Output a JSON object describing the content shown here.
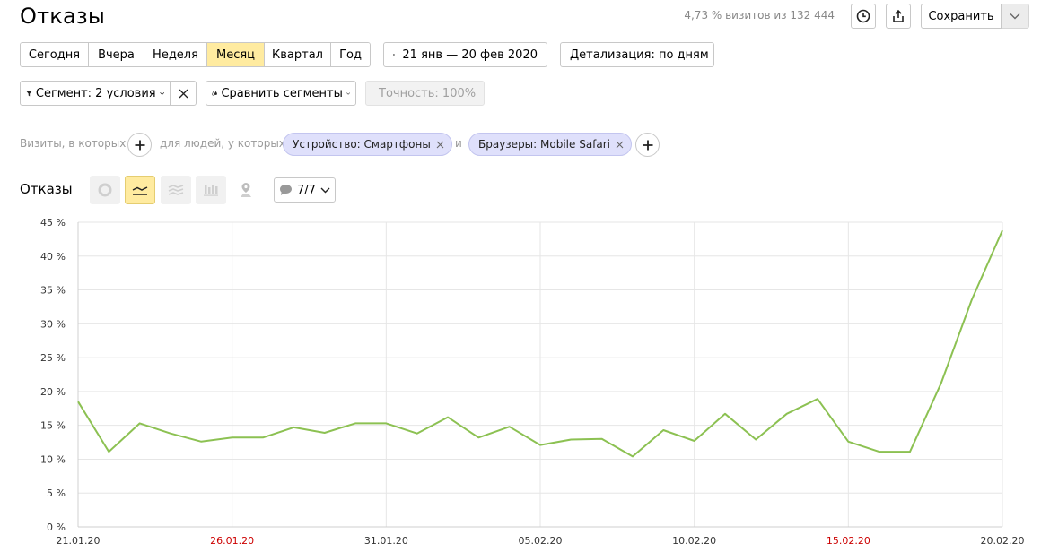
{
  "header": {
    "title": "Отказы",
    "summary": "4,73 % визитов из 132 444",
    "save_label": "Сохранить",
    "icons": [
      "clock-icon",
      "share-icon",
      "chevron-down-icon"
    ]
  },
  "period": {
    "buttons": [
      "Сегодня",
      "Вчера",
      "Неделя",
      "Месяц",
      "Квартал",
      "Год"
    ],
    "active": "Месяц",
    "date_range": "21 янв — 20 фев 2020",
    "detail": "Детализация: по дням"
  },
  "segment": {
    "label": "Сегмент: 2 условия",
    "compare": "Сравнить сегменты",
    "accuracy": "Точность: 100%"
  },
  "filters": {
    "visits_label": "Визиты, в которых",
    "people_label": "для людей, у которых",
    "and_label": "и",
    "chips": [
      "Устройство: Смартфоны",
      "Браузеры: Mobile Safari"
    ]
  },
  "chart_section": {
    "title": "Отказы",
    "annotations_label": "7/7",
    "tools": [
      "pie-chart-icon",
      "line-chart-icon",
      "area-chart-icon",
      "bar-chart-icon",
      "map-icon"
    ]
  },
  "colors": {
    "line": "#8cc152",
    "active": "#ffeba0",
    "weekend": "#cc0000",
    "chip": "#dfe0fb"
  },
  "chart_data": {
    "type": "line",
    "series": [
      {
        "values": [
          18.5,
          11.1,
          15.3,
          13.8,
          12.6,
          13.2,
          13.2,
          14.7,
          13.9,
          15.3,
          15.3,
          13.8,
          16.2,
          13.2,
          14.8,
          12.1,
          12.9,
          13.0,
          10.4,
          14.3,
          12.7,
          16.7,
          12.9,
          16.7,
          18.9,
          12.6,
          11.1,
          11.1,
          21.1,
          33.5,
          43.8
        ]
      }
    ],
    "x_start": "21.01.20",
    "x_end": "20.02.20",
    "x_ticks": [
      "21.01.20",
      "26.01.20",
      "31.01.20",
      "05.02.20",
      "10.02.20",
      "15.02.20",
      "20.02.20"
    ],
    "weekend_ticks": [
      "26.01.20",
      "15.02.20"
    ],
    "y_ticks": [
      "0 %",
      "5 %",
      "10 %",
      "15 %",
      "20 %",
      "25 %",
      "30 %",
      "35 %",
      "40 %",
      "45 %"
    ],
    "ylim": [
      0,
      45
    ],
    "grid": true
  }
}
